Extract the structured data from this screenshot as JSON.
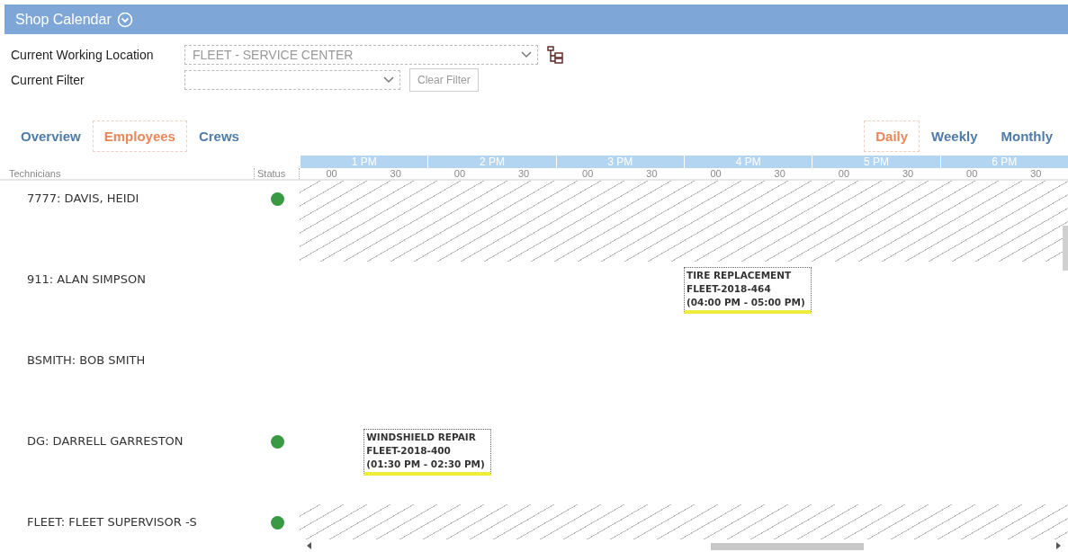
{
  "header": {
    "title": "Shop Calendar"
  },
  "location": {
    "label": "Current Working Location",
    "value": "FLEET - SERVICE CENTER"
  },
  "filter": {
    "label": "Current Filter",
    "button": {
      "label": "Clear Filter",
      "disabled": true
    }
  },
  "tabs": [
    {
      "label": "Overview",
      "selected": false
    },
    {
      "label": "Employees",
      "selected": true
    },
    {
      "label": "Crews",
      "selected": false
    }
  ],
  "views": [
    {
      "label": "Daily",
      "selected": true
    },
    {
      "label": "Weekly",
      "selected": false
    },
    {
      "label": "Monthly",
      "selected": false
    }
  ],
  "timeline": {
    "technicians_label": "Technicians",
    "status_label": "Status",
    "hours": [
      {
        "label": "1 PM",
        "minutes": [
          "00",
          "30"
        ]
      },
      {
        "label": "2 PM",
        "minutes": [
          "00",
          "30"
        ]
      },
      {
        "label": "3 PM",
        "minutes": [
          "00",
          "30"
        ]
      },
      {
        "label": "4 PM",
        "minutes": [
          "00",
          "30"
        ]
      },
      {
        "label": "5 PM",
        "minutes": [
          "00",
          "30"
        ]
      },
      {
        "label": "6 PM",
        "minutes": [
          "00",
          "30"
        ]
      }
    ]
  },
  "technicians": [
    {
      "name": "7777: DAVIS, HEIDI",
      "color": "#3a9a44",
      "blocked": true
    },
    {
      "name": "911: ALAN SIMPSON",
      "blocked": false,
      "events": [
        {
          "title": "TIRE REPLACEMENT",
          "number": "FLEET-2018-464",
          "time": "(04:00 PM - 05:00 PM)"
        }
      ]
    },
    {
      "name": "BSMITH: BOB SMITH",
      "blocked": false
    },
    {
      "name": "DG: DARRELL GARRESTON",
      "color": "#3a9a44",
      "blocked": false,
      "events": [
        {
          "title": "WINDSHIELD REPAIR",
          "number": "FLEET-2018-400",
          "time": "(01:30 PM - 02:30 PM)"
        }
      ]
    },
    {
      "name": "FLEET: FLEET SUPERVISOR -S",
      "color": "#3a9a44",
      "blocked": true
    }
  ]
}
